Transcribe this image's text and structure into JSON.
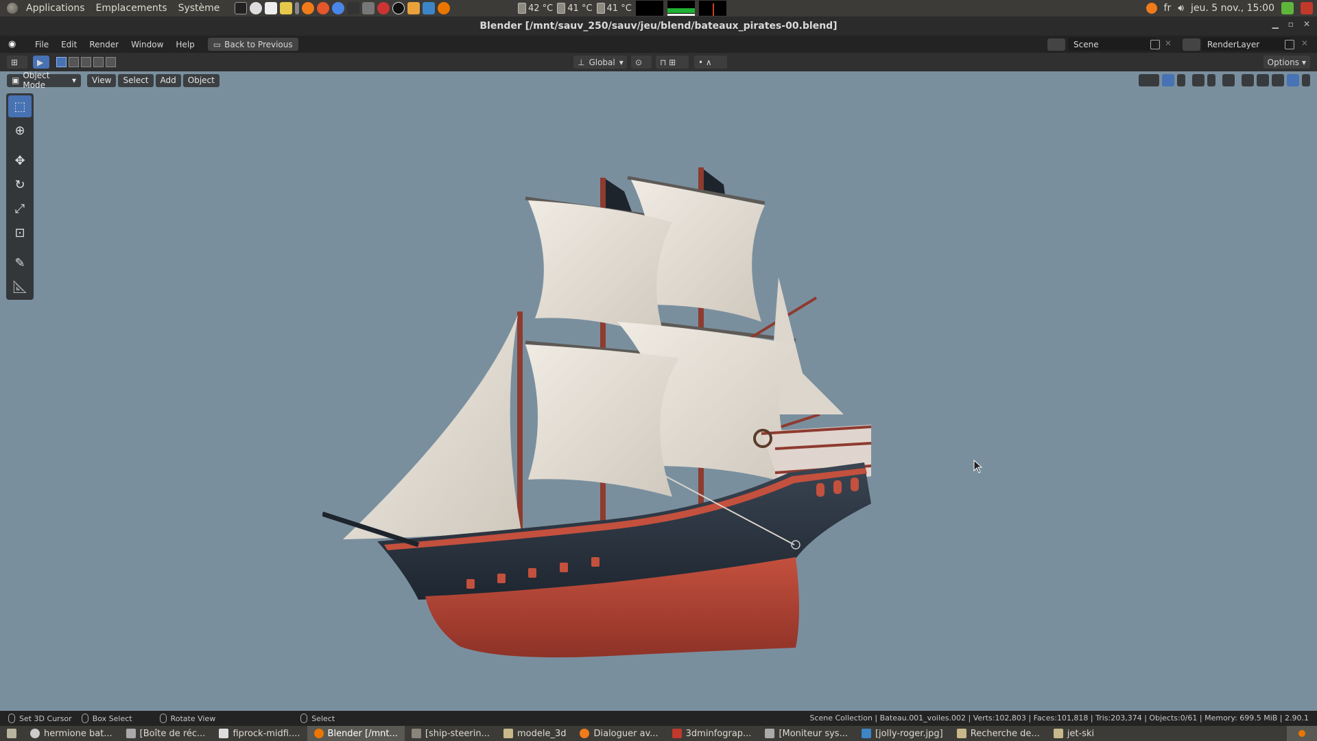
{
  "top_panel": {
    "menus": [
      "Applications",
      "Emplacements",
      "Système"
    ],
    "sensors": [
      "42 °C",
      "41 °C",
      "41 °C"
    ],
    "tray": {
      "language": "fr",
      "datetime": "jeu. 5 nov., 15:00"
    },
    "launcher_icons": [
      "terminal-icon",
      "disk-icon",
      "files-icon",
      "photo-icon",
      "apps-icon",
      "xampp-icon",
      "firefox-icon",
      "chromium-icon",
      "inkscape-icon",
      "gimp-icon",
      "obs-icon",
      "krita-icon",
      "godot-icon",
      "blender-icon"
    ]
  },
  "window": {
    "title": "Blender [/mnt/sauv_250/sauv/jeu/blend/bateaux_pirates-00.blend]"
  },
  "blender_topbar": {
    "menus": [
      "File",
      "Edit",
      "Render",
      "Window",
      "Help"
    ],
    "back_button": "Back to Previous",
    "scene": "Scene",
    "render_layer": "RenderLayer"
  },
  "tool_header": {
    "orientation": "Global",
    "options": "Options"
  },
  "viewport_header": {
    "mode": "Object Mode",
    "menus": [
      "View",
      "Select",
      "Add",
      "Object"
    ]
  },
  "toolbar_tools": [
    "select-box-icon",
    "cursor-icon",
    "move-icon",
    "rotate-icon",
    "scale-icon",
    "transform-icon",
    "annotate-icon",
    "measure-icon"
  ],
  "statusbar": {
    "hints": [
      "Set 3D Cursor",
      "Box Select",
      "Rotate View",
      "Select"
    ],
    "info": "Scene Collection | Bateau.001_voiles.002 | Verts:102,803 | Faces:101,818 | Tris:203,374 | Objects:0/61 | Memory: 699.5 MiB | 2.90.1"
  },
  "taskbar": {
    "items": [
      {
        "label": "hermione bat...",
        "active": false
      },
      {
        "label": "[Boîte de réc...",
        "active": false
      },
      {
        "label": "fiprock-midfi....",
        "active": false
      },
      {
        "label": "Blender [/mnt...",
        "active": true
      },
      {
        "label": "[ship-steerin...",
        "active": false
      },
      {
        "label": "modele_3d",
        "active": false
      },
      {
        "label": "Dialoguer av...",
        "active": false
      },
      {
        "label": "3dminfograp...",
        "active": false
      },
      {
        "label": "[Moniteur sys...",
        "active": false
      },
      {
        "label": "[jolly-roger.jpg]",
        "active": false
      },
      {
        "label": "Recherche de...",
        "active": false
      },
      {
        "label": "jet-ski",
        "active": false
      }
    ]
  },
  "colors": {
    "viewport_bg": "#7a8f9e",
    "accent": "#4772b3",
    "hull_dark": "#2a3340",
    "hull_red": "#b8483a",
    "sail": "#e8e2d8"
  }
}
